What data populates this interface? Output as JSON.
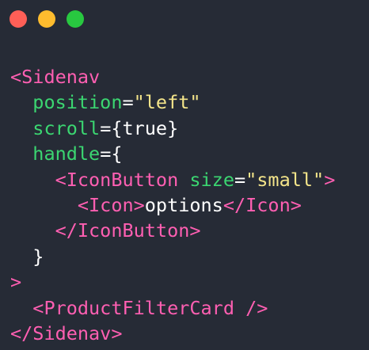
{
  "window": {
    "controls": {
      "close_color": "#ff5f57",
      "minimize_color": "#febc2e",
      "maximize_color": "#28c840"
    }
  },
  "code": {
    "lines": [
      [
        {
          "t": "tag",
          "v": "<Sidenav"
        }
      ],
      [
        {
          "t": "txt",
          "v": "  "
        },
        {
          "t": "attr",
          "v": "position"
        },
        {
          "t": "txt",
          "v": "="
        },
        {
          "t": "str",
          "v": "\"left\""
        }
      ],
      [
        {
          "t": "txt",
          "v": "  "
        },
        {
          "t": "attr",
          "v": "scroll"
        },
        {
          "t": "txt",
          "v": "={true}"
        }
      ],
      [
        {
          "t": "txt",
          "v": "  "
        },
        {
          "t": "attr",
          "v": "handle"
        },
        {
          "t": "txt",
          "v": "={"
        }
      ],
      [
        {
          "t": "txt",
          "v": "    "
        },
        {
          "t": "tag",
          "v": "<IconButton"
        },
        {
          "t": "txt",
          "v": " "
        },
        {
          "t": "attr",
          "v": "size"
        },
        {
          "t": "txt",
          "v": "="
        },
        {
          "t": "str",
          "v": "\"small\""
        },
        {
          "t": "tag",
          "v": ">"
        }
      ],
      [
        {
          "t": "txt",
          "v": "      "
        },
        {
          "t": "tag",
          "v": "<Icon>"
        },
        {
          "t": "txt",
          "v": "options"
        },
        {
          "t": "tag",
          "v": "</Icon>"
        }
      ],
      [
        {
          "t": "txt",
          "v": "    "
        },
        {
          "t": "tag",
          "v": "</IconButton>"
        }
      ],
      [
        {
          "t": "txt",
          "v": "  }"
        }
      ],
      [
        {
          "t": "tag",
          "v": ">"
        }
      ],
      [
        {
          "t": "txt",
          "v": "  "
        },
        {
          "t": "tag",
          "v": "<ProductFilterCard />"
        }
      ],
      [
        {
          "t": "tag",
          "v": "</Sidenav>"
        }
      ]
    ]
  }
}
